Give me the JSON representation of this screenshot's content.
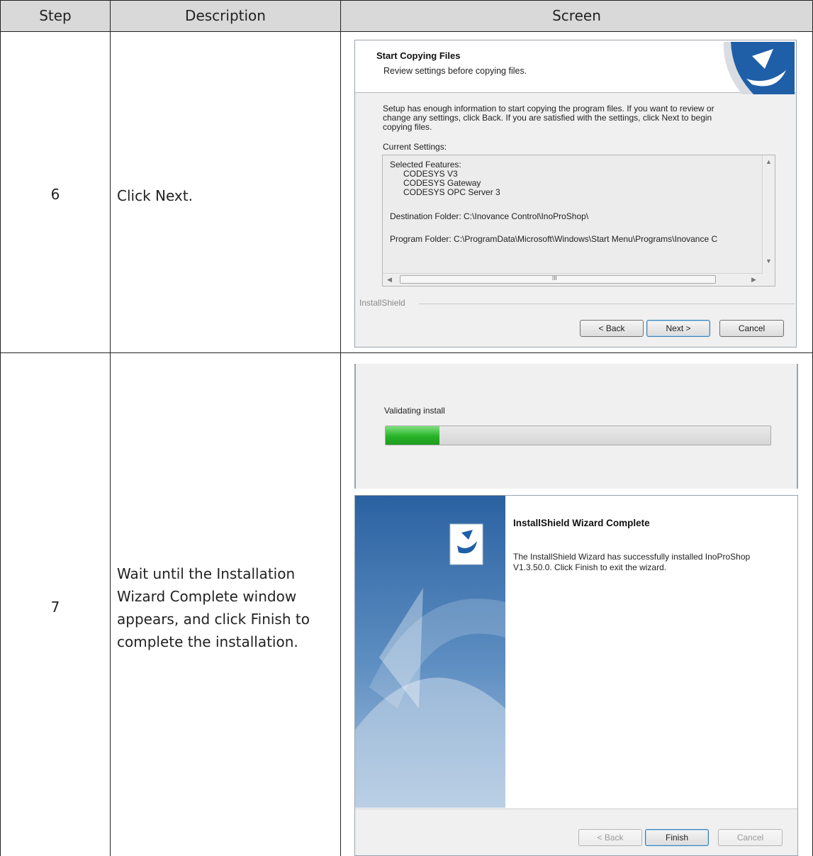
{
  "table": {
    "headers": {
      "step": "Step",
      "description": "Description",
      "screen": "Screen"
    },
    "rows": [
      {
        "step": "6",
        "description": "Click Next."
      },
      {
        "step": "7",
        "description_lines": [
          "Wait until the Installation",
          "Wizard Complete window",
          "appears, and click Finish to",
          "complete the installation."
        ]
      }
    ]
  },
  "copy_dialog": {
    "title": "Start Copying Files",
    "subtitle": "Review settings before copying files.",
    "body_lines": [
      "Setup has enough information to start copying the program files.  If you want to review or",
      "change any settings, click Back.  If you are satisfied with the settings, click Next to begin",
      "copying files."
    ],
    "current_settings_label": "Current Settings:",
    "settings": {
      "features_label": "Selected Features:",
      "features": [
        "CODESYS V3",
        "CODESYS Gateway",
        "CODESYS OPC Server 3"
      ],
      "destination": "Destination Folder: C:\\Inovance Control\\InoProShop\\",
      "program_folder": "Program Folder: C:\\ProgramData\\Microsoft\\Windows\\Start Menu\\Programs\\Inovance C"
    },
    "brand": "InstallShield",
    "buttons": {
      "back": "< Back",
      "next": "Next >",
      "cancel": "Cancel"
    },
    "scroll_thumb_glyph": "III"
  },
  "progress_dialog": {
    "status_text": "Validating install",
    "progress_fraction": 0.14,
    "progress_color": "#27b327"
  },
  "complete_dialog": {
    "title": "InstallShield Wizard Complete",
    "message_lines": [
      "The InstallShield Wizard has successfully installed InoProShop",
      "V1.3.50.0.  Click Finish to exit the wizard."
    ],
    "buttons": {
      "back": "< Back",
      "finish": "Finish",
      "cancel": "Cancel"
    }
  },
  "colors": {
    "header_bg": "#d9d9d9",
    "side_panel_blue": "#2f6aa6",
    "install_logo_blue": "#1f5fa8"
  }
}
